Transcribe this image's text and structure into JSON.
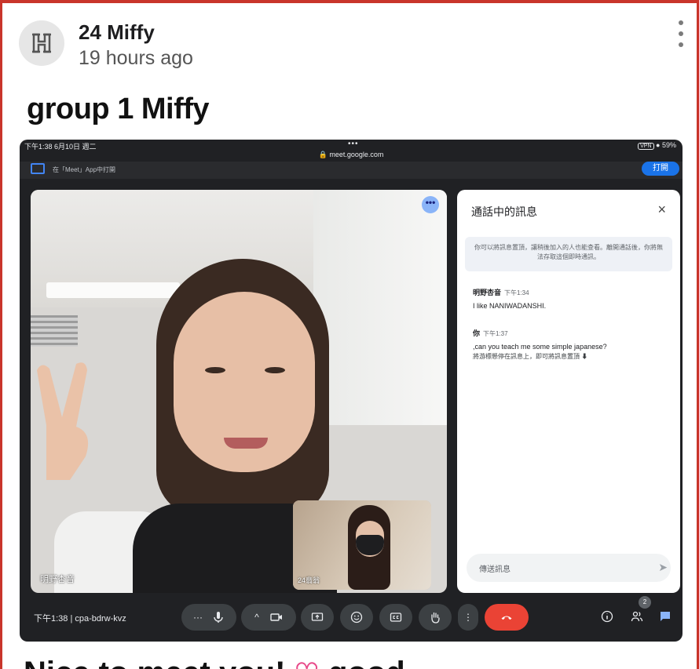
{
  "post": {
    "author": "24 Miffy",
    "time": "19 hours ago",
    "title": "group 1 Miffy",
    "bottom_text_a": "Nice to meet you!",
    "bottom_text_b": "good"
  },
  "device": {
    "status_left": "下午1:38  6月10日 週二",
    "status_dots": "•••",
    "status_right": "● 59%",
    "vpn": "VPN",
    "url": "🔒 meet.google.com"
  },
  "meet_banner": {
    "hint": "在「Meet」App中打開",
    "open_label": "打開"
  },
  "participants": {
    "main_name": "明野杏音",
    "self_name": "24翡翁"
  },
  "chat": {
    "title": "通話中的訊息",
    "close": "×",
    "notice": "你可以將訊息置頂，讓稍後加入的人也能查看。離開通話後，你將無法存取這個即時通訊。",
    "messages": [
      {
        "sender": "明野杏音",
        "time": "下午1:34",
        "text": "I like NANIWADANSHI."
      },
      {
        "sender": "你",
        "time": "下午1:37",
        "text": ",can you teach me some simple japanese?",
        "tip": "將游標懸停在訊息上，即可將訊息置頂 ⬇"
      }
    ],
    "input_placeholder": "傳送訊息"
  },
  "controls": {
    "meeting_info": "下午1:38  |  cpa-bdrw-kvz",
    "more": "···",
    "caret": "^",
    "kebab": "⋮",
    "people_count": "2"
  },
  "colors": {
    "frame_red": "#c9352b",
    "meet_dark": "#202124",
    "end_call": "#ea4335",
    "accent_blue": "#1a73e8"
  }
}
